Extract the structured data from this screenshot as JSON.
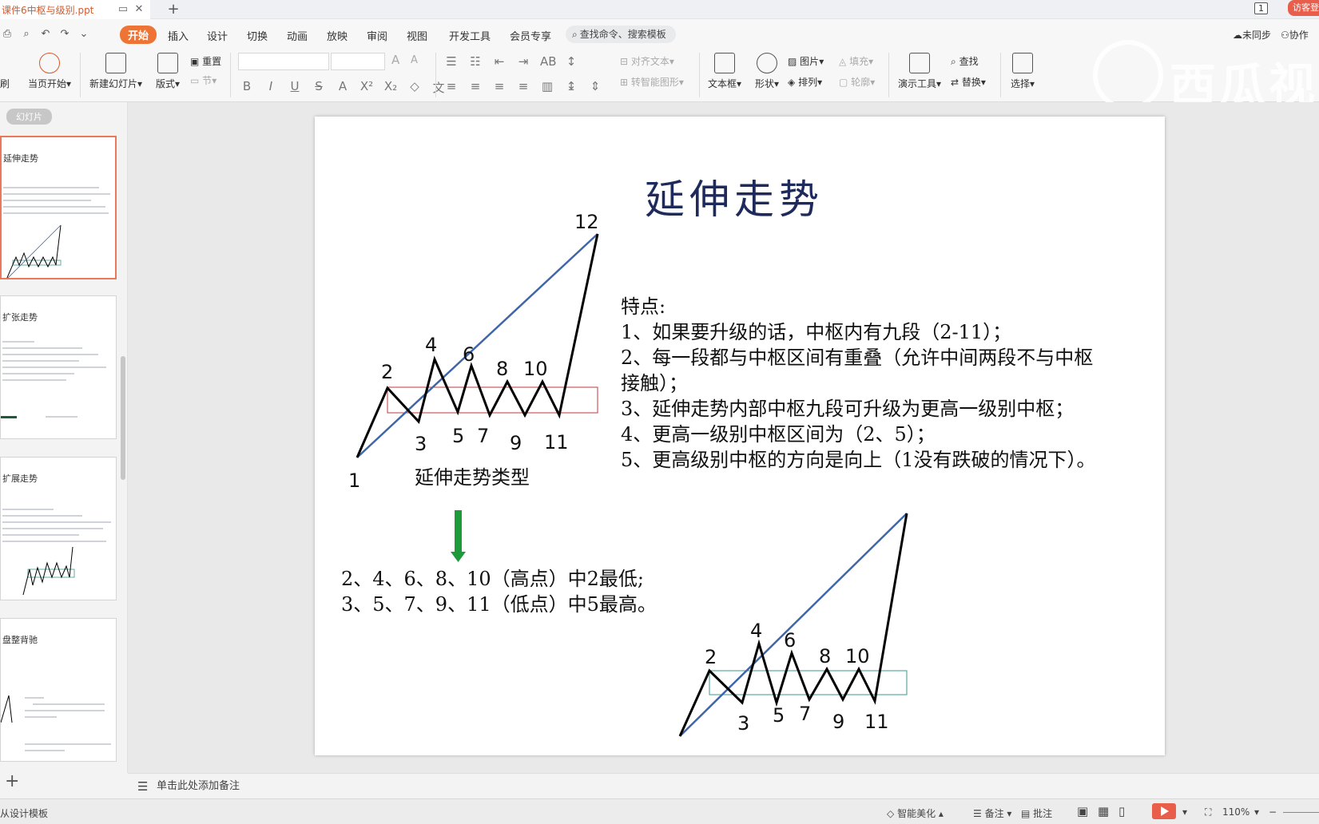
{
  "titlebar": {
    "doc_name": "课件6中枢与级别.ppt",
    "new_tab": "+",
    "window_count": "1",
    "visitor": "访客登"
  },
  "menu": {
    "items": [
      "开始",
      "插入",
      "设计",
      "切换",
      "动画",
      "放映",
      "审阅",
      "视图",
      "开发工具",
      "会员专享"
    ],
    "active": "开始",
    "search_placeholder": "查找命令、搜索模板",
    "sync": "未同步",
    "collab": "协作"
  },
  "ribbon": {
    "format_brush": "刷",
    "from_current": "当页开始",
    "new_slide": "新建幻灯片",
    "layout": "版式",
    "reset": "重置",
    "section": "节",
    "text_box": "文本框",
    "shape": "形状",
    "picture": "图片",
    "arrange": "排列",
    "fill": "填充",
    "outline": "轮廓",
    "presentation_tools": "演示工具",
    "find": "查找",
    "replace": "替换",
    "select": "选择",
    "align_text": "对齐文本",
    "smart_graphic": "转智能图形"
  },
  "watermark": "西瓜视",
  "slides_panel": {
    "label": "幻灯片",
    "thumbs": [
      {
        "title": "延伸走势"
      },
      {
        "title": "扩张走势"
      },
      {
        "title": "扩展走势"
      },
      {
        "title": "盘整背驰"
      }
    ]
  },
  "slide": {
    "title": "延伸走势",
    "features_heading": "特点:",
    "features": [
      "1、如果要升级的话，中枢内有九段（2-11）；",
      "2、每一段都与中枢区间有重叠（允许中间两段不与中枢",
      "接触）；",
      "3、延伸走势内部中枢九段可升级为更高一级别中枢；",
      "4、更高一级别中枢区间为（2、5）；",
      "5、更高级别中枢的方向是向上（1没有跌破的情况下）。"
    ],
    "chart_caption": "延伸走势类型",
    "notes": [
      "2、4、6、8、10（高点）中2最低;",
      "3、5、7、9、11（低点）中5最高。"
    ],
    "top_chart_labels": [
      "1",
      "2",
      "3",
      "4",
      "5",
      "6",
      "7",
      "8",
      "9",
      "10",
      "11",
      "12"
    ],
    "bottom_chart_labels": [
      "2",
      "3",
      "4",
      "5",
      "6",
      "7",
      "8",
      "9",
      "10",
      "11"
    ],
    "colors": {
      "wave": "#000000",
      "trend_line": "#3f66a8",
      "top_box": "#c0393b",
      "bottom_box": "#3a9a8a",
      "arrow": "#1d9a3a",
      "title": "#1f2a5c"
    }
  },
  "notes_bar": {
    "placeholder": "单击此处添加备注"
  },
  "statusbar": {
    "template": "从设计模板",
    "smart_beautify": "智能美化",
    "notes": "备注",
    "comments": "批注",
    "zoom": "110%"
  }
}
